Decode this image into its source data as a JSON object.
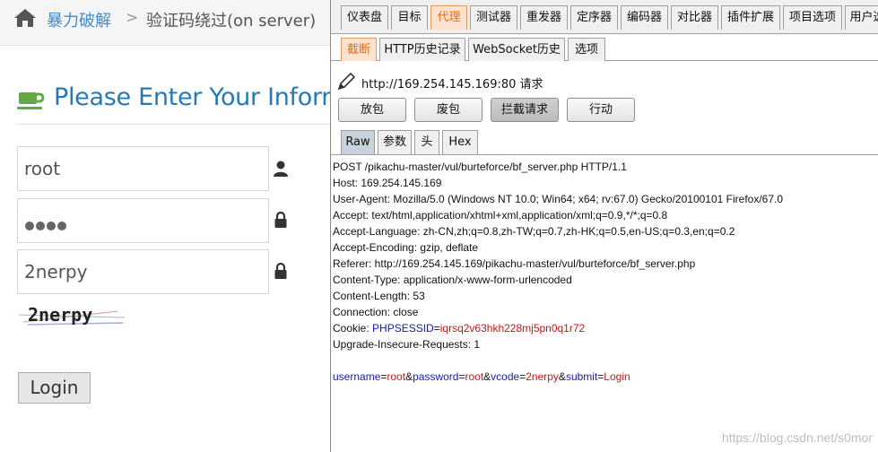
{
  "left": {
    "breadcrumb": {
      "section": "暴力破解",
      "separator": ">",
      "current": "验证码绕过(on server)"
    },
    "title": "Please Enter Your Information",
    "username_value": "root",
    "password_mask_count": 4,
    "vcode_value": "2nerpy",
    "captcha_text": "2nerpy",
    "login_label": "Login",
    "icons": {
      "home": "home-icon",
      "title": "coffee-cup-icon",
      "username": "user-icon",
      "password": "lock-icon",
      "vcode": "lock-icon"
    },
    "colors": {
      "link": "#428bca",
      "title": "#2679b5",
      "cup": "#64a745"
    }
  },
  "burp": {
    "main_tabs": [
      "仪表盘",
      "目标",
      "代理",
      "测试器",
      "重发器",
      "定序器",
      "编码器",
      "对比器",
      "插件扩展",
      "项目选项",
      "用户选"
    ],
    "active_main_tab": "代理",
    "sub_tabs": [
      "截断",
      "HTTP历史记录",
      "WebSocket历史",
      "选项"
    ],
    "active_sub_tab": "截断",
    "request_label": "http://169.254.145.169:80 请求",
    "buttons": {
      "forward": "放包",
      "drop": "废包",
      "intercept": "拦截请求",
      "action": "行动"
    },
    "editor_tabs": [
      "Raw",
      "参数",
      "头",
      "Hex"
    ],
    "active_editor_tab": "Raw",
    "request": {
      "request_line": "POST /pikachu-master/vul/burteforce/bf_server.php HTTP/1.1",
      "host": "Host: 169.254.145.169",
      "user_agent": "User-Agent: Mozilla/5.0 (Windows NT 10.0; Win64; x64; rv:67.0) Gecko/20100101 Firefox/67.0",
      "accept": "Accept: text/html,application/xhtml+xml,application/xml;q=0.9,*/*;q=0.8",
      "accept_language": "Accept-Language: zh-CN,zh;q=0.8,zh-TW;q=0.7,zh-HK;q=0.5,en-US;q=0.3,en;q=0.2",
      "accept_encoding": "Accept-Encoding: gzip, deflate",
      "referer": "Referer: http://169.254.145.169/pikachu-master/vul/burteforce/bf_server.php",
      "content_type": "Content-Type: application/x-www-form-urlencoded",
      "content_length": "Content-Length: 53",
      "connection": "Connection: close",
      "cookie_prefix": "Cookie: ",
      "cookie_name": "PHPSESSID",
      "cookie_eq": "=",
      "cookie_value": "iqrsq2v63hkh228mj5pn0q1r72",
      "upgrade": "Upgrade-Insecure-Requests: 1",
      "body": {
        "username_key": "username",
        "username_val": "root",
        "password_key": "password",
        "password_val": "root",
        "vcode_key": "vcode",
        "vcode_val": "2nerpy",
        "submit_key": "submit",
        "submit_val": "Login",
        "eq": "=",
        "amp": "&"
      }
    },
    "colors": {
      "accent": "#e86c16",
      "param_name": "#1b1ba8",
      "param_value": "#c01a1a"
    }
  },
  "watermark": "https://blog.csdn.net/s0mor"
}
